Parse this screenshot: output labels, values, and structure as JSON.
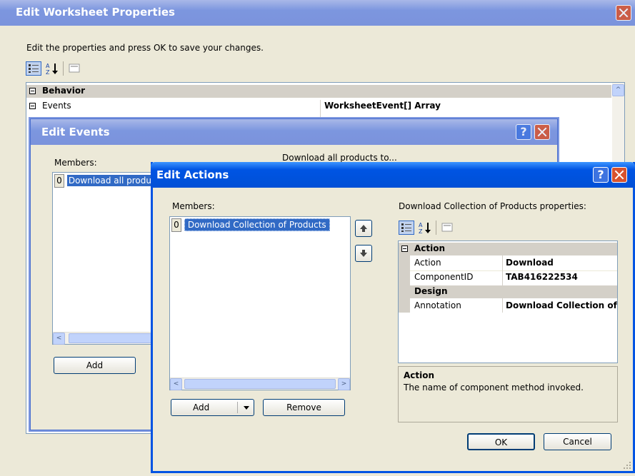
{
  "worksheet_dialog": {
    "title": "Edit Worksheet Properties",
    "instructions": "Edit the properties and press OK to save your changes.",
    "grid": {
      "categories": [
        "Behavior"
      ],
      "rows": [
        {
          "name": "Events",
          "value": "WorksheetEvent[] Array"
        }
      ]
    }
  },
  "events_dialog": {
    "title": "Edit Events",
    "help": "?",
    "members_label": "Members:",
    "properties_label_partial": "Download all products to...",
    "members": [
      {
        "index": "0",
        "label": "Download all products"
      }
    ],
    "add_label": "Add"
  },
  "actions_dialog": {
    "title": "Edit Actions",
    "help": "?",
    "members_label": "Members:",
    "properties_label": "Download Collection of Products properties:",
    "members": [
      {
        "index": "0",
        "label": "Download Collection of Products"
      }
    ],
    "add_label": "Add",
    "remove_label": "Remove",
    "ok_label": "OK",
    "cancel_label": "Cancel",
    "grid": {
      "sections": [
        {
          "category": "Action",
          "rows": [
            {
              "name": "Action",
              "value": "Download"
            },
            {
              "name": "ComponentID",
              "value": "TAB416222534"
            }
          ]
        },
        {
          "category": "Design",
          "rows": [
            {
              "name": "Annotation",
              "value": "Download Collection of Products"
            }
          ]
        }
      ]
    },
    "description": {
      "title": "Action",
      "text": "The name of component method invoked."
    }
  },
  "colors": {
    "titlebar": "#0054e3",
    "titlebar_inactive": "#7c96df",
    "dialog_face": "#ece9d8",
    "selection": "#316ac5",
    "category_row": "#d4d0c8"
  }
}
